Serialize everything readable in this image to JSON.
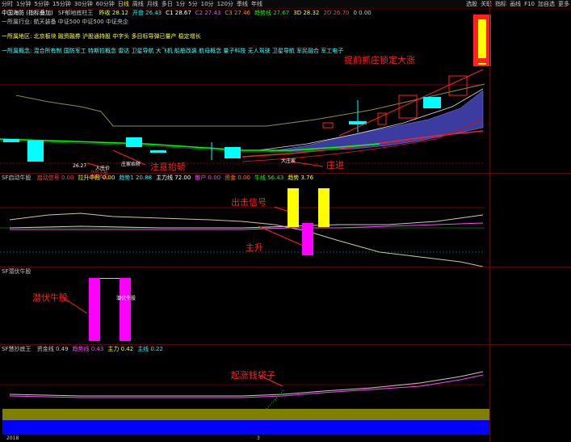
{
  "toolbar": {
    "periods": [
      "分时",
      "1分钟",
      "5分钟",
      "15分钟",
      "30分钟",
      "60分钟",
      "日线",
      "周线",
      "月线",
      "多日",
      "1分",
      "5分",
      "10分",
      "120分",
      "季线",
      "年线"
    ],
    "active_period": "日线",
    "title_left": "中国海防",
    "title_right_items": [
      "选股",
      "关联",
      "指标",
      "画线",
      "F10",
      "加自选",
      "更多"
    ]
  },
  "main_panel": {
    "header_stock": "中国海防 (指标叠加)",
    "header_indicator": "SF郁地底柱王",
    "header_values": [
      {
        "label": "昨收",
        "value": "28.12",
        "color": "#ffff00"
      },
      {
        "label": "开盘",
        "value": "26.43",
        "color": "#00ffff"
      },
      {
        "label": "C1",
        "value": "28.67",
        "color": "#ffffff"
      },
      {
        "label": "C2",
        "value": "27.43",
        "color": "#ff44ff"
      },
      {
        "label": "C3",
        "value": "27.46",
        "color": "#ff8800"
      },
      {
        "label": "趋势线",
        "value": "27.67",
        "color": "#00ff00"
      },
      {
        "label": "3D",
        "value": "28.32",
        "color": "#ffff00"
      },
      {
        "label": "2D",
        "value": "26.70",
        "color": "#ff4040"
      },
      {
        "label": "0",
        "value": "0.00",
        "color": "#c8c8c8"
      }
    ],
    "info_line1": "一所属行业: 航天装备    中证500  中证500  中证央企",
    "info_line2": "一所属地区: 北京板块    融资融券  沪股通持股  中字头  多目标导弹已量产  稳定增长",
    "info_line3": "一所属概念: 混合所有制  国防军工  特斯拉概念  雷达  卫星导航  大飞机  船舶改装  航母概念  量子科技  无人驾驶  卫星导航  军民融合  军工电子",
    "annotations": {
      "top_right": "提前抓庄锁定大涨",
      "mid_left": "注意抬轿",
      "bottom_left": "踩线",
      "main_force": "庄进",
      "sm_zhu": "庄家抬轿",
      "sm_ru": "入庄",
      "sm_dai": "大庄家",
      "sm_price": "26.27",
      "sm_entry": "入庄价"
    }
  },
  "panel2": {
    "header": "SF启动牛股",
    "values": [
      {
        "label": "启动信号",
        "value": "0.00",
        "color": "#ff4040"
      },
      {
        "label": "拉升中段",
        "value": "0.00",
        "color": "#ffff00"
      },
      {
        "label": "趋势1",
        "value": "20.88",
        "color": "#00ffff"
      },
      {
        "label": "主力线",
        "value": "72.00",
        "color": "#ffffff"
      },
      {
        "label": "散户",
        "value": "0.00",
        "color": "#ff44ff"
      },
      {
        "label": "资金",
        "value": "0.00",
        "color": "#ff8800"
      },
      {
        "label": "牛线",
        "value": "56.43",
        "color": "#00ff00"
      },
      {
        "label": "趋势",
        "value": "3.76",
        "color": "#ffff00"
      }
    ],
    "signal_label": "出击信号",
    "rise_label": "主升"
  },
  "panel3": {
    "header": "SF潜伏牛股",
    "label": "潜伏牛股",
    "box_text": "潜伏牛股"
  },
  "panel4": {
    "header": "SF慧抄底王",
    "values": [
      {
        "label": "资金线",
        "value": "0.49",
        "color": "#c8c8c8"
      },
      {
        "label": "趋势线",
        "value": "0.43",
        "color": "#ff44ff"
      },
      {
        "label": "主力",
        "value": "0.42",
        "color": "#ffff00"
      },
      {
        "label": "主线",
        "value": "0.22",
        "color": "#00ffff"
      }
    ],
    "label": "起涨钱袋子"
  },
  "colors": {
    "up": "#ff2020",
    "down": "#00ffff",
    "cloud": "#3c3ca0",
    "olive": "#808000",
    "blue": "#0000ff",
    "signal_yellow": "#ffff00",
    "magenta": "#ff00ff"
  },
  "status": {
    "date_left": "2018",
    "date_right": "3"
  }
}
